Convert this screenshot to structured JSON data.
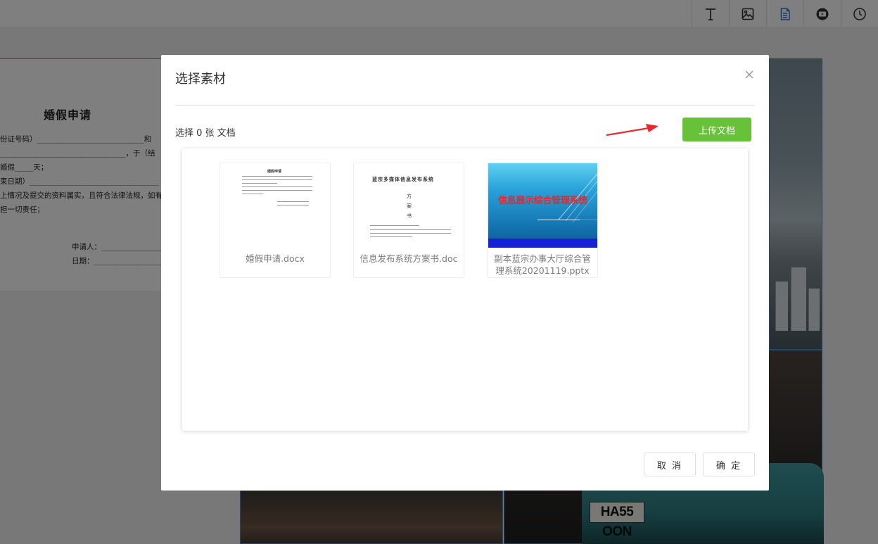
{
  "toolbar": {
    "tools": [
      {
        "icon": "text-icon"
      },
      {
        "icon": "image-icon"
      },
      {
        "icon": "document-icon",
        "active": true
      },
      {
        "icon": "video-icon"
      },
      {
        "icon": "clock-icon"
      }
    ],
    "active_color": "#3478d4"
  },
  "background_doc": {
    "title": "婚假申请",
    "lines": [
      "份证号码）_____________________________和",
      "__________________________________，于（结",
      "婚假_____天；",
      "束日期）___________________________________",
      "上情况及提交的资料属实，且符合法律法规，如有虚假",
      "担一切责任；",
      "申请人：_______________________",
      "日期：_________________________"
    ]
  },
  "background_photo": {
    "plate_text": "HA55 OON"
  },
  "dialog": {
    "title": "选择素材",
    "selected_count_text": "选择 0 张 文档",
    "upload_label": "上传文档",
    "cancel_label": "取 消",
    "confirm_label": "确 定",
    "files": [
      {
        "name": "婚假申请.docx",
        "thumb_title": "婚假申请"
      },
      {
        "name": "信息发布系统方案书.doc",
        "thumb_title": "蓝宗多媒体信息发布系统",
        "thumb_chars": [
          "方",
          "案",
          "书"
        ]
      },
      {
        "name": "副本蓝宗办事大厅综合管理系统20201119.pptx",
        "thumb_title": "信息展示综合管理系统"
      }
    ]
  },
  "colors": {
    "upload_button": "#67c23a",
    "arrow": "#e8282b",
    "ppt_title": "#e8262c",
    "ppt_bar": "#1622d8"
  }
}
